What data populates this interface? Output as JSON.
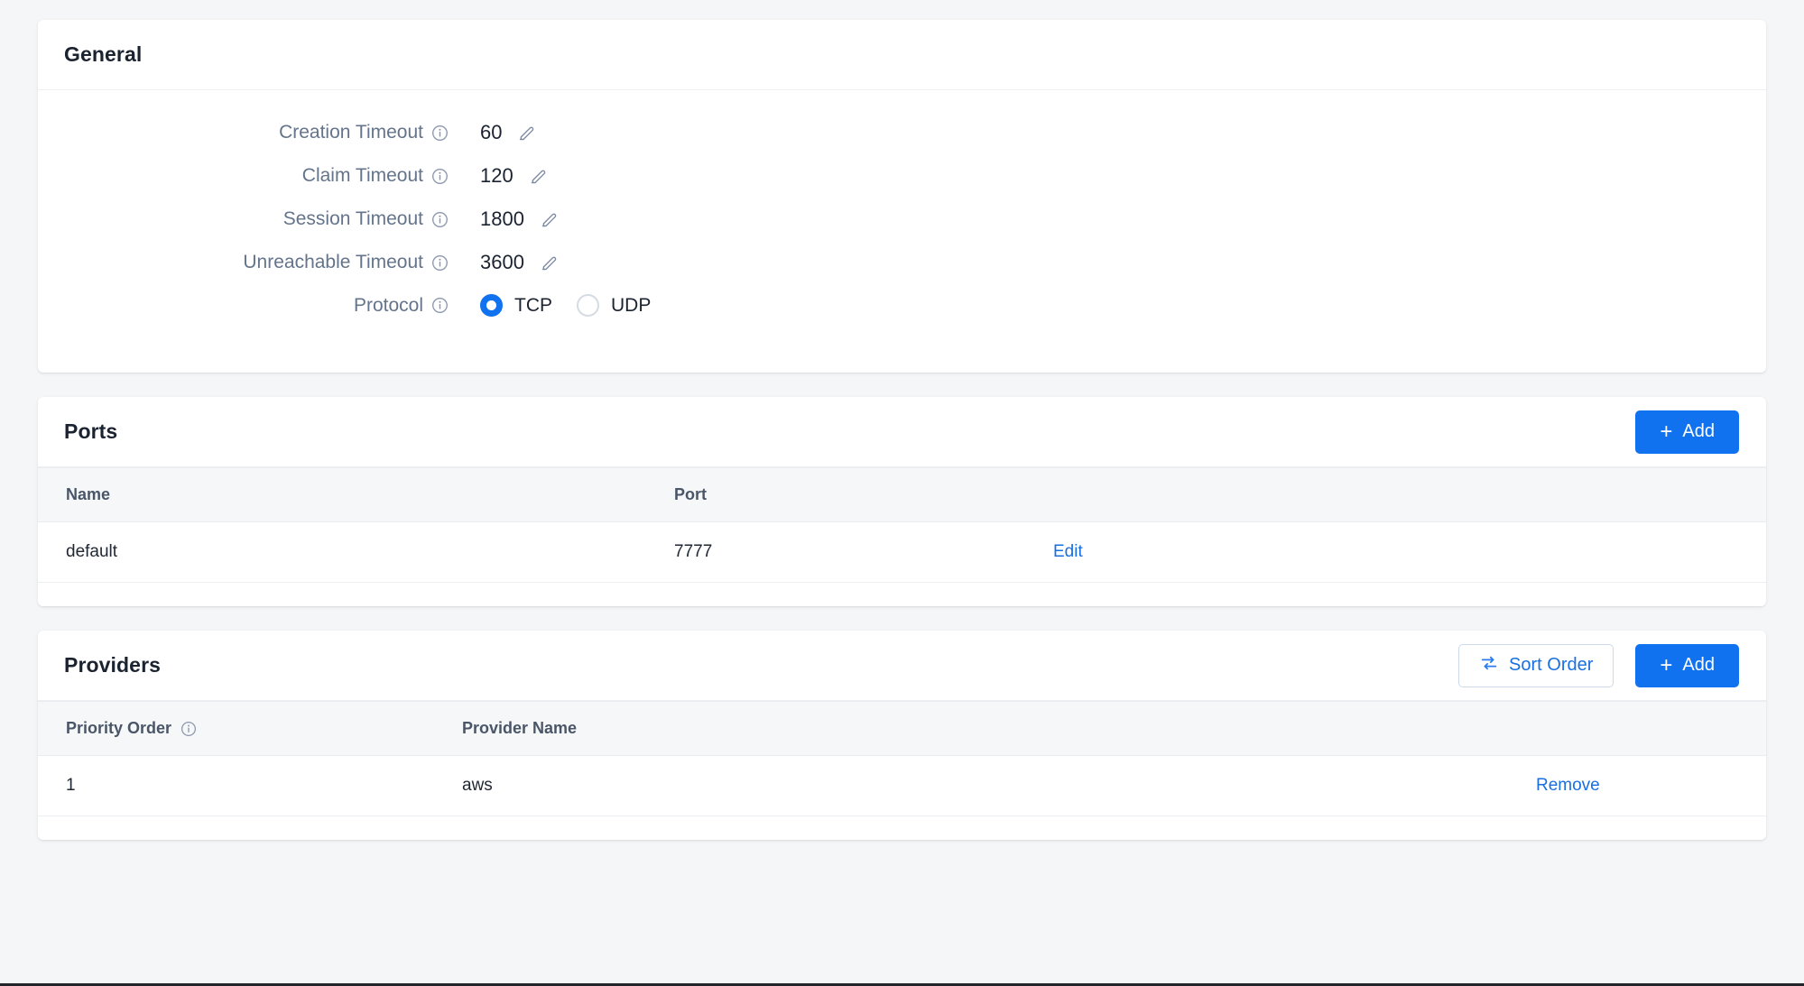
{
  "theme": {
    "accent": "#1172f0",
    "link": "#1a6fe0",
    "label": "#64748b",
    "text": "#1b2330",
    "page_bg": "#f4f6f8",
    "card_bg": "#ffffff",
    "table_header_bg": "#f5f7f9"
  },
  "general": {
    "title": "General",
    "fields": [
      {
        "label": "Creation Timeout",
        "value": "60",
        "info_icon": "info-icon",
        "edit_icon": "pencil-icon"
      },
      {
        "label": "Claim Timeout",
        "value": "120",
        "info_icon": "info-icon",
        "edit_icon": "pencil-icon"
      },
      {
        "label": "Session Timeout",
        "value": "1800",
        "info_icon": "info-icon",
        "edit_icon": "pencil-icon"
      },
      {
        "label": "Unreachable Timeout",
        "value": "3600",
        "info_icon": "info-icon",
        "edit_icon": "pencil-icon"
      }
    ],
    "protocol": {
      "label": "Protocol",
      "info_icon": "info-icon",
      "selected": "TCP",
      "options": [
        {
          "label": "TCP",
          "checked": true
        },
        {
          "label": "UDP",
          "checked": false
        }
      ]
    }
  },
  "ports": {
    "title": "Ports",
    "add_button": {
      "label": "Add",
      "icon": "plus-icon"
    },
    "columns": [
      "Name",
      "Port",
      ""
    ],
    "rows": [
      {
        "name": "default",
        "port": "7777",
        "action": "Edit"
      }
    ]
  },
  "providers": {
    "title": "Providers",
    "sort_button": {
      "label": "Sort Order",
      "icon": "swap-arrows-icon"
    },
    "add_button": {
      "label": "Add",
      "icon": "plus-icon"
    },
    "columns": [
      "Priority Order",
      "Provider Name",
      ""
    ],
    "priority_info_icon": "info-icon",
    "rows": [
      {
        "priority": "1",
        "provider": "aws",
        "action": "Remove"
      }
    ]
  }
}
